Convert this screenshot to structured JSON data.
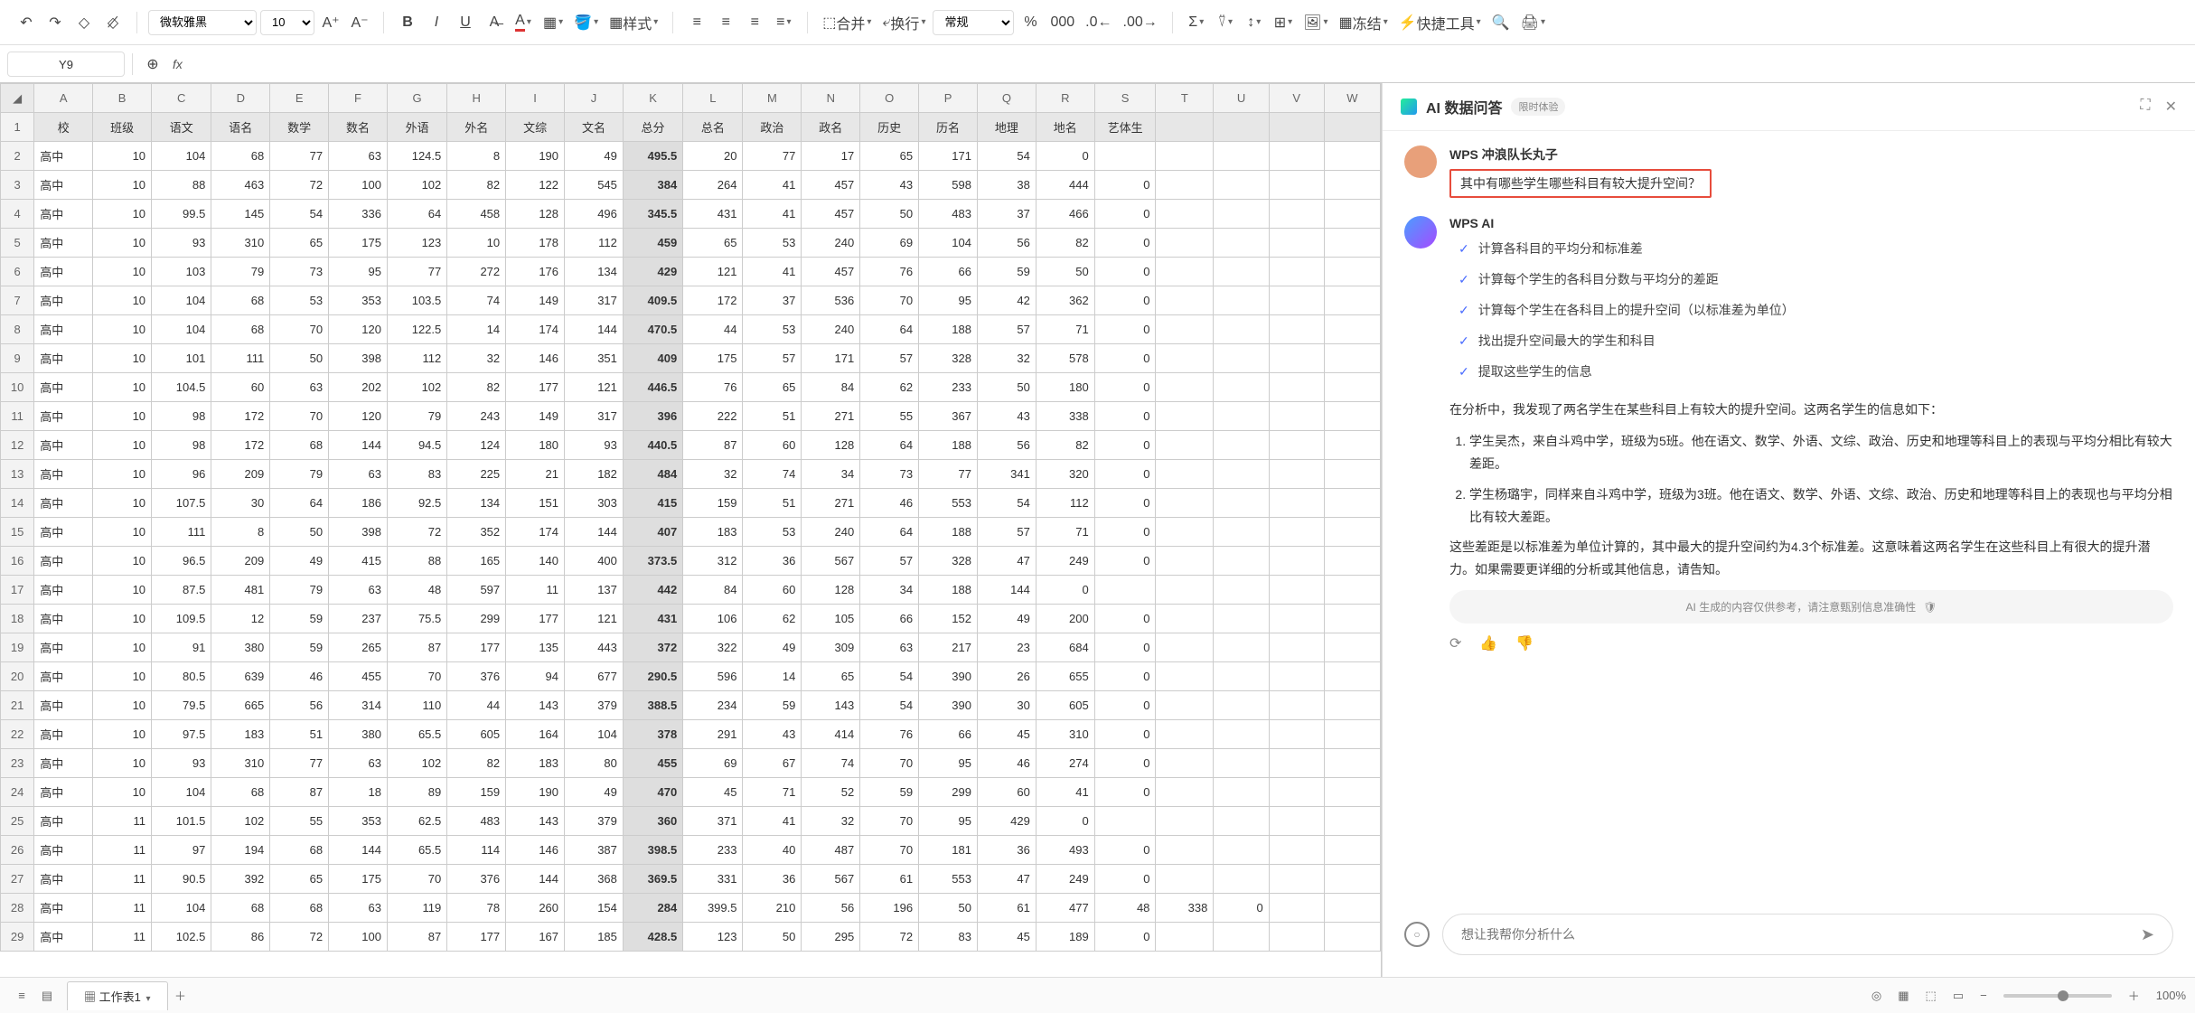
{
  "toolbar": {
    "font": "微软雅黑",
    "font_size": "10",
    "style_label": "样式",
    "merge_label": "合并",
    "wrap_label": "换行",
    "format_label": "常规",
    "freeze_label": "冻结",
    "tools_label": "快捷工具"
  },
  "formula_bar": {
    "cell_ref": "Y9"
  },
  "columns": [
    "A",
    "B",
    "C",
    "D",
    "E",
    "F",
    "G",
    "H",
    "I",
    "J",
    "K",
    "L",
    "M",
    "N",
    "O",
    "P",
    "Q",
    "R",
    "S",
    "T",
    "U",
    "V",
    "W"
  ],
  "headers": [
    "校",
    "班级",
    "语文",
    "语名",
    "数学",
    "数名",
    "外语",
    "外名",
    "文综",
    "文名",
    "总分",
    "总名",
    "政治",
    "政名",
    "历史",
    "历名",
    "地理",
    "地名",
    "艺体生"
  ],
  "rows": [
    [
      "高中",
      10,
      104,
      68,
      77,
      63,
      124.5,
      8,
      190,
      49,
      "495.5",
      20,
      77,
      17,
      65,
      171,
      54,
      0
    ],
    [
      "高中",
      10,
      88,
      463,
      72,
      100,
      102,
      82,
      122,
      545,
      "384",
      264,
      41,
      457,
      43,
      598,
      38,
      444,
      0
    ],
    [
      "高中",
      10,
      99.5,
      145,
      54,
      336,
      64,
      458,
      128,
      496,
      "345.5",
      431,
      41,
      457,
      50,
      483,
      37,
      466,
      0
    ],
    [
      "高中",
      10,
      93,
      310,
      65,
      175,
      123,
      10,
      178,
      112,
      "459",
      65,
      53,
      240,
      69,
      104,
      56,
      82,
      0
    ],
    [
      "高中",
      10,
      103,
      79,
      73,
      95,
      77,
      272,
      176,
      134,
      "429",
      121,
      41,
      457,
      76,
      66,
      59,
      50,
      0
    ],
    [
      "高中",
      10,
      104,
      68,
      53,
      353,
      103.5,
      74,
      149,
      317,
      "409.5",
      172,
      37,
      536,
      70,
      95,
      42,
      362,
      0
    ],
    [
      "高中",
      10,
      104,
      68,
      70,
      120,
      122.5,
      14,
      174,
      144,
      "470.5",
      44,
      53,
      240,
      64,
      188,
      57,
      71,
      0
    ],
    [
      "高中",
      10,
      101,
      111,
      50,
      398,
      112,
      32,
      146,
      351,
      "409",
      175,
      57,
      171,
      57,
      328,
      32,
      578,
      0
    ],
    [
      "高中",
      10,
      104.5,
      60,
      63,
      202,
      102,
      82,
      177,
      121,
      "446.5",
      76,
      65,
      84,
      62,
      233,
      50,
      180,
      0
    ],
    [
      "高中",
      10,
      98,
      172,
      70,
      120,
      79,
      243,
      149,
      317,
      "396",
      222,
      51,
      271,
      55,
      367,
      43,
      338,
      0
    ],
    [
      "高中",
      10,
      98,
      172,
      68,
      144,
      94.5,
      124,
      180,
      93,
      "440.5",
      87,
      60,
      128,
      64,
      188,
      56,
      82,
      0
    ],
    [
      "高中",
      10,
      96,
      209,
      79,
      63,
      83,
      225,
      21,
      182,
      "484",
      32,
      74,
      34,
      73,
      77,
      341,
      320,
      0
    ],
    [
      "高中",
      10,
      107.5,
      30,
      64,
      186,
      92.5,
      134,
      151,
      303,
      "415",
      159,
      51,
      271,
      46,
      553,
      54,
      112,
      0
    ],
    [
      "高中",
      10,
      111,
      8,
      50,
      398,
      72,
      352,
      174,
      144,
      "407",
      183,
      53,
      240,
      64,
      188,
      57,
      71,
      0
    ],
    [
      "高中",
      10,
      96.5,
      209,
      49,
      415,
      88,
      165,
      140,
      400,
      "373.5",
      312,
      36,
      567,
      57,
      328,
      47,
      249,
      0
    ],
    [
      "高中",
      10,
      87.5,
      481,
      79,
      63,
      48,
      597,
      11,
      137,
      "442",
      84,
      60,
      128,
      34,
      188,
      144,
      0
    ],
    [
      "高中",
      10,
      109.5,
      12,
      59,
      237,
      75.5,
      299,
      177,
      121,
      "431",
      106,
      62,
      105,
      66,
      152,
      49,
      200,
      0
    ],
    [
      "高中",
      10,
      91,
      380,
      59,
      265,
      87,
      177,
      135,
      443,
      "372",
      322,
      49,
      309,
      63,
      217,
      23,
      684,
      0
    ],
    [
      "高中",
      10,
      80.5,
      639,
      46,
      455,
      70,
      376,
      94,
      677,
      "290.5",
      596,
      14,
      65,
      54,
      390,
      26,
      655,
      0
    ],
    [
      "高中",
      10,
      79.5,
      665,
      56,
      314,
      110,
      44,
      143,
      379,
      "388.5",
      234,
      59,
      143,
      54,
      390,
      30,
      605,
      0
    ],
    [
      "高中",
      10,
      97.5,
      183,
      51,
      380,
      65.5,
      605,
      164,
      104,
      "378",
      291,
      43,
      414,
      76,
      66,
      45,
      310,
      0
    ],
    [
      "高中",
      10,
      93,
      310,
      77,
      63,
      102,
      82,
      183,
      80,
      "455",
      69,
      67,
      74,
      70,
      95,
      46,
      274,
      0
    ],
    [
      "高中",
      10,
      104,
      68,
      87,
      18,
      89,
      159,
      190,
      49,
      "470",
      45,
      71,
      52,
      59,
      299,
      60,
      41,
      0
    ],
    [
      "高中",
      11,
      101.5,
      102,
      55,
      353,
      62.5,
      483,
      143,
      379,
      "360",
      371,
      41,
      32,
      70,
      95,
      429,
      0
    ],
    [
      "高中",
      11,
      97,
      194,
      68,
      144,
      65.5,
      114,
      146,
      387,
      "398.5",
      233,
      40,
      487,
      70,
      181,
      36,
      493,
      0
    ],
    [
      "高中",
      11,
      90.5,
      392,
      65,
      175,
      70,
      376,
      144,
      368,
      "369.5",
      331,
      36,
      567,
      61,
      553,
      47,
      249,
      0
    ],
    [
      "高中",
      11,
      104,
      68,
      68,
      63,
      119,
      78,
      260,
      154,
      284,
      "399.5",
      210,
      56,
      196,
      50,
      61,
      477,
      48,
      338,
      0
    ],
    [
      "高中",
      11,
      102.5,
      86,
      72,
      100,
      87,
      177,
      167,
      185,
      "428.5",
      123,
      50,
      295,
      72,
      83,
      45,
      189,
      0
    ]
  ],
  "ai": {
    "title": "AI 数据问答",
    "badge": "限时体验",
    "user_name": "WPS 冲浪队长丸子",
    "user_question": "其中有哪些学生哪些科目有较大提升空间？",
    "ai_name": "WPS AI",
    "steps": [
      "计算各科目的平均分和标准差",
      "计算每个学生的各科目分数与平均分的差距",
      "计算每个学生在各科目上的提升空间（以标准差为单位）",
      "找出提升空间最大的学生和科目",
      "提取这些学生的信息"
    ],
    "answer_intro": "在分析中，我发现了两名学生在某些科目上有较大的提升空间。这两名学生的信息如下：",
    "answer_items": [
      "学生吴杰，来自斗鸡中学，班级为5班。他在语文、数学、外语、文综、政治、历史和地理等科目上的表现与平均分相比有较大差距。",
      "学生杨璐宇，同样来自斗鸡中学，班级为3班。他在语文、数学、外语、文综、政治、历史和地理等科目上的表现也与平均分相比有较大差距。"
    ],
    "answer_foot": "这些差距是以标准差为单位计算的，其中最大的提升空间约为4.3个标准差。这意味着这两名学生在这些科目上有很大的提升潜力。如果需要更详细的分析或其他信息，请告知。",
    "disclaimer": "AI 生成的内容仅供参考，请注意甄别信息准确性",
    "input_placeholder": "想让我帮你分析什么"
  },
  "bottom": {
    "sheet_name": "工作表1",
    "zoom": "100%"
  }
}
